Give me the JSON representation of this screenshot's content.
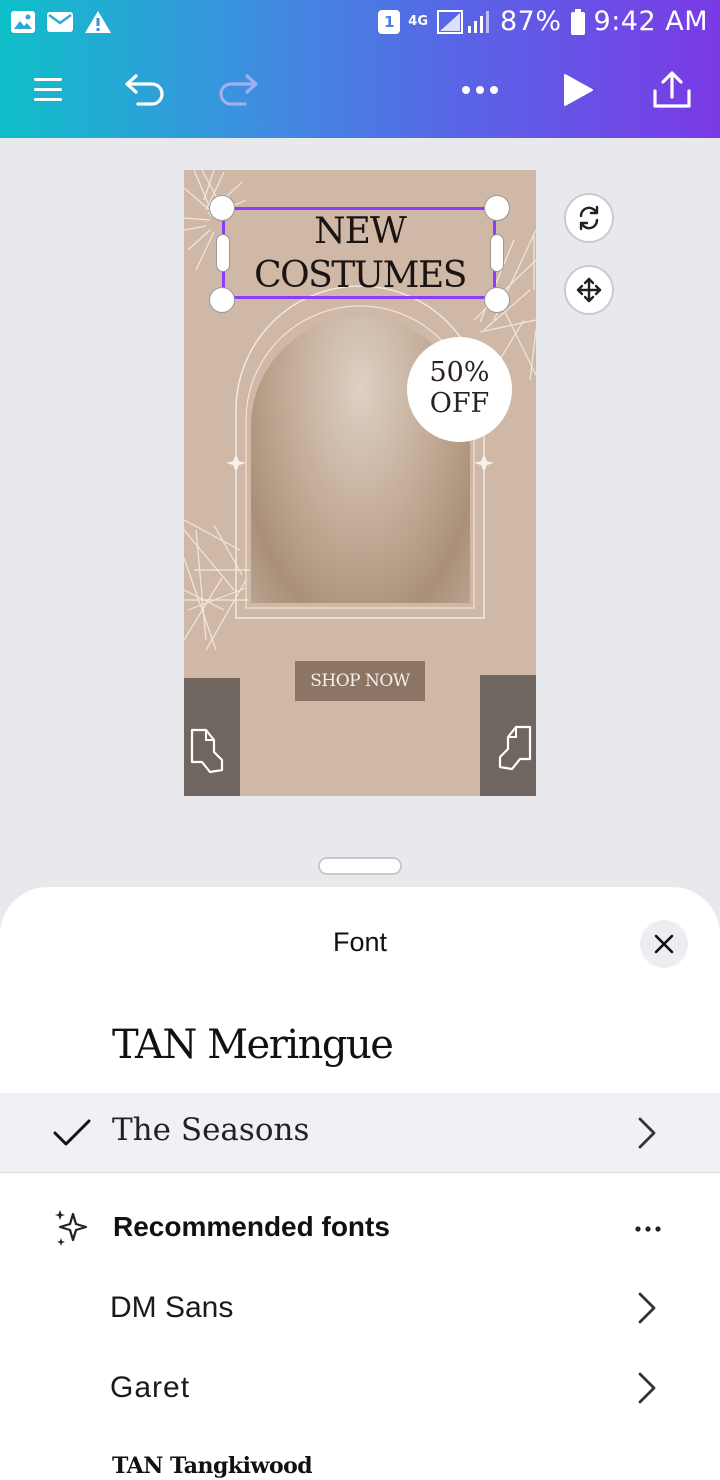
{
  "status_bar": {
    "sim_slot": "1",
    "network": "4G",
    "battery": "87%",
    "time": "9:42 AM"
  },
  "toolbar": {
    "menu_icon": "hamburger-menu-icon",
    "undo_icon": "undo-icon",
    "redo_icon": "redo-icon",
    "more_icon": "more-dots-icon",
    "play_icon": "play-icon",
    "share_icon": "share-upload-icon"
  },
  "design": {
    "headline_line1": "NEW",
    "headline_line2": "COSTUMES",
    "badge_line1": "50%",
    "badge_line2": "OFF",
    "cta": "SHOP NOW",
    "colors": {
      "background": "#d0b8a7",
      "button": "#8c7564",
      "selection": "#8b3dff"
    }
  },
  "sheet": {
    "title": "Font",
    "brand_font": "TAN Meringue",
    "selected_font": "The Seasons",
    "recommended_title": "Recommended fonts",
    "fonts": [
      "DM Sans",
      "Garet"
    ],
    "last_font": "TAN Tangkiwood"
  }
}
